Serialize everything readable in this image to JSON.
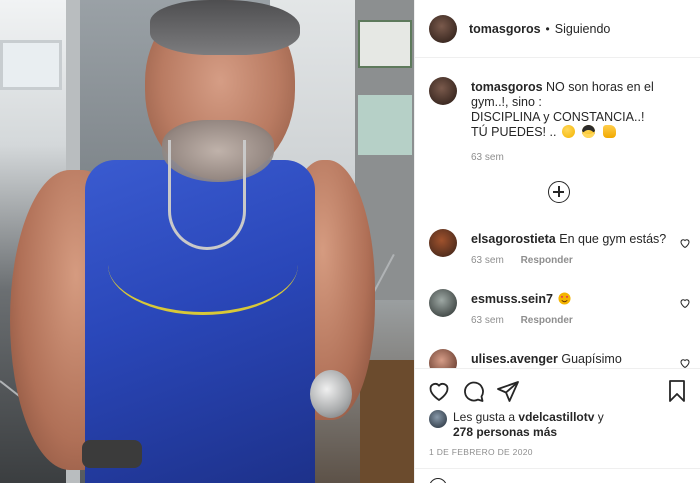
{
  "post": {
    "author": "tomasgoros",
    "separator": "•",
    "follow_status": "Siguiendo"
  },
  "caption": {
    "author": "tomasgoros",
    "text_line1": "NO son horas en el gym..!, sino :",
    "text_line2": "DISCIPLINA y CONSTANCIA..!",
    "text_line3": "TÚ PUEDES! ..",
    "time": "63 sem"
  },
  "comments": [
    {
      "user": "elsagorostieta",
      "text": "En que gym estás?",
      "time": "63 sem",
      "reply": "Responder"
    },
    {
      "user": "esmuss.sein7",
      "text": "",
      "time": "63 sem",
      "reply": "Responder"
    },
    {
      "user": "ulises.avenger",
      "text": "Guapísimo",
      "time": "",
      "reply": ""
    }
  ],
  "likes": {
    "prefix": "Les gusta a",
    "user": "vdelcastillotv",
    "conjunction": "y",
    "count_text": "278 personas más"
  },
  "date": "1 DE FEBRERO DE 2020",
  "icons": [
    "heart-icon",
    "comment-icon",
    "share-icon",
    "bookmark-icon",
    "plus-circle-icon",
    "smiley-icon"
  ]
}
